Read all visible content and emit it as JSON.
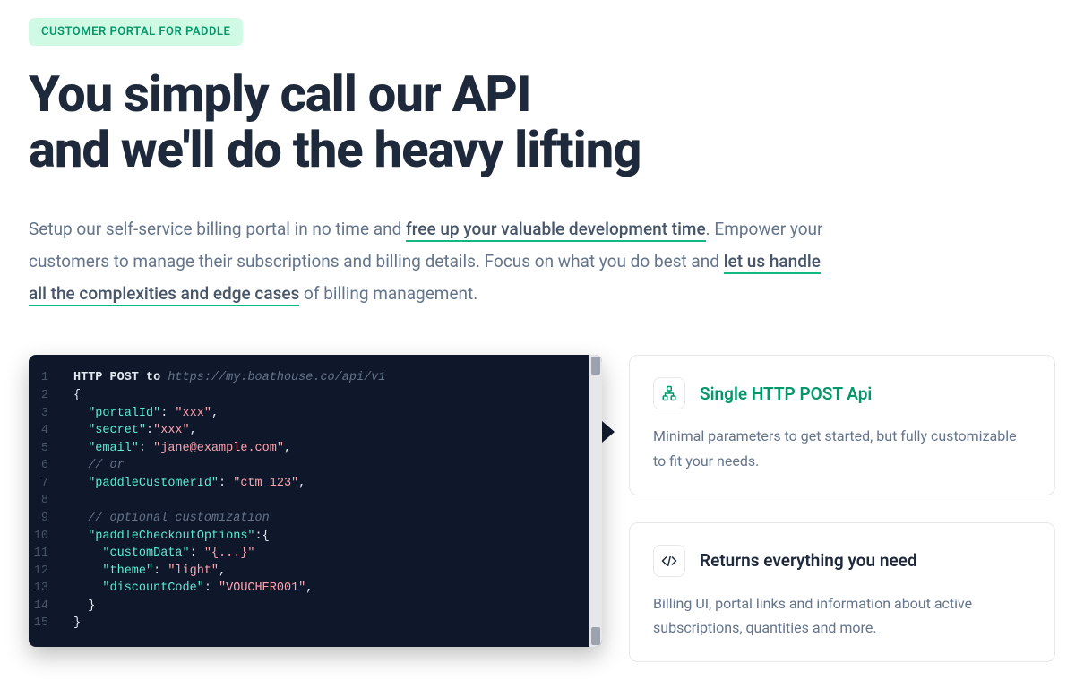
{
  "badge": "CUSTOMER PORTAL FOR PADDLE",
  "heading_line1": "You simply call our API",
  "heading_line2": "and we'll do the heavy lifting",
  "lead": {
    "part1": "Setup our self-service billing portal in no time and ",
    "u1": "free up your valuable development time",
    "part2": ". Empower your customers to manage their subscriptions and billing details. Focus on what you do best and ",
    "u2": "let us handle all the complexities and edge cases",
    "part3": " of billing management."
  },
  "code": {
    "http_prefix": "HTTP POST to ",
    "url": "https://my.boathouse.co/api/v1",
    "lines": [
      {
        "n": 1
      },
      {
        "n": 2,
        "raw": "{"
      },
      {
        "n": 3,
        "key": "portalId",
        "val": "xxx",
        "comma": true
      },
      {
        "n": 4,
        "key": "secret",
        "val": "xxx",
        "comma": true,
        "tight": true
      },
      {
        "n": 5,
        "key": "email",
        "val": "jane@example.com",
        "comma": true
      },
      {
        "n": 6,
        "comment": "// or"
      },
      {
        "n": 7,
        "key": "paddleCustomerId",
        "val": "ctm_123",
        "comma": true
      },
      {
        "n": 8,
        "blank": true
      },
      {
        "n": 9,
        "comment": "// optional customization"
      },
      {
        "n": 10,
        "key": "paddleCheckoutOptions",
        "open": true,
        "tight": true
      },
      {
        "n": 11,
        "indent": 2,
        "key": "customData",
        "val": "{...}",
        "comma": false
      },
      {
        "n": 12,
        "indent": 2,
        "key": "theme",
        "val": "light",
        "comma": true
      },
      {
        "n": 13,
        "indent": 2,
        "key": "discountCode",
        "val": "VOUCHER001",
        "comma": true
      },
      {
        "n": 14,
        "raw": "  }"
      },
      {
        "n": 15,
        "raw": "}"
      }
    ]
  },
  "cards": [
    {
      "icon": "hierarchy-icon",
      "title": "Single HTTP POST Api",
      "accent": true,
      "body": "Minimal parameters to get started, but fully customizable to fit your needs."
    },
    {
      "icon": "code-slash-icon",
      "title": "Returns everything you need",
      "accent": false,
      "body": "Billing UI, portal links and information about active subscriptions, quantities and more."
    }
  ]
}
